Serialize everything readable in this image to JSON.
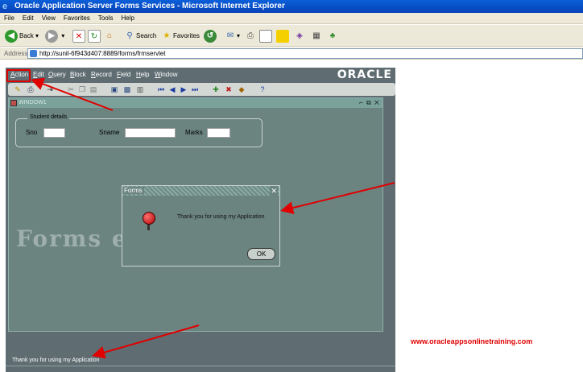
{
  "browser": {
    "title": "Oracle Application Server Forms Services - Microsoft Internet Explorer",
    "menu": [
      "File",
      "Edit",
      "View",
      "Favorites",
      "Tools",
      "Help"
    ],
    "toolbar": {
      "back_label": "Back",
      "search_label": "Search",
      "favorites_label": "Favorites"
    },
    "address_label": "Address",
    "address_value": "http://sunil-6f943d407:8889/forms/frmservlet"
  },
  "forms": {
    "menu": [
      "Action",
      "Edit",
      "Query",
      "Block",
      "Record",
      "Field",
      "Help",
      "Window"
    ],
    "logo": "ORACLE",
    "window_title": "WINDOW1",
    "frame_title": "Student details",
    "fields": {
      "sno_label": "Sno",
      "sname_label": "Sname",
      "marks_label": "Marks",
      "sno_value": "",
      "sname_value": "",
      "marks_value": ""
    },
    "watermark": "Forms ee Neeu",
    "dialog": {
      "title": "Forms",
      "message": "Thank you for using my Application",
      "ok_label": "OK",
      "close_glyph": "✕"
    },
    "status": "Thank you for using my Application"
  },
  "annotation": {
    "website": "www.oracleappsonlinetraining.com",
    "arrow_color": "#e00000"
  }
}
